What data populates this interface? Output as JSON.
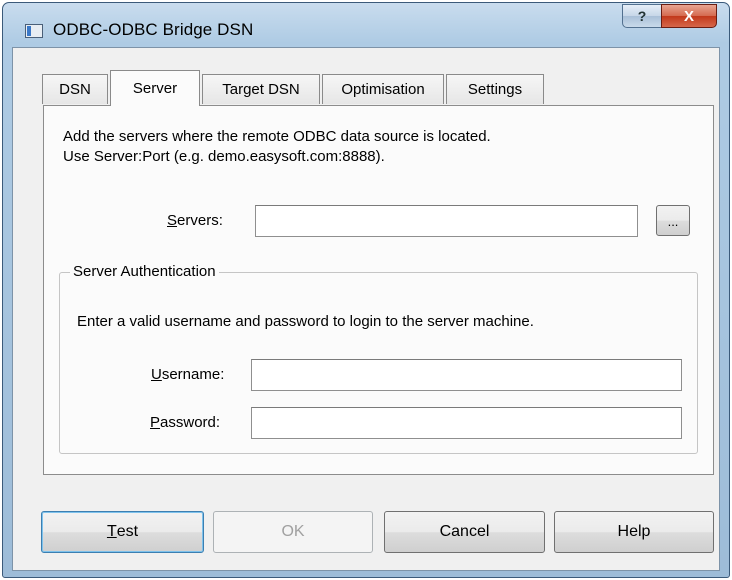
{
  "window": {
    "title": "ODBC-ODBC Bridge DSN"
  },
  "caption_buttons": {
    "help": "?",
    "close": "X"
  },
  "tabs": [
    {
      "label": "DSN"
    },
    {
      "label": "Server"
    },
    {
      "label": "Target DSN"
    },
    {
      "label": "Optimisation"
    },
    {
      "label": "Settings"
    }
  ],
  "active_tab": "Server",
  "server_tab": {
    "info_line1": "Add the servers where the remote ODBC data source is located.",
    "info_line2": "Use Server:Port (e.g. demo.easysoft.com:8888).",
    "servers": {
      "label_mnemonic": "S",
      "label_rest": "ervers:",
      "value": ""
    },
    "browse_label": "...",
    "auth": {
      "group_title": "Server Authentication",
      "hint": "Enter a valid username and password to login to the server machine.",
      "username": {
        "label_mnemonic": "U",
        "label_rest": "sername:",
        "value": ""
      },
      "password": {
        "label_mnemonic": "P",
        "label_rest": "assword:",
        "value": ""
      }
    }
  },
  "buttons": {
    "test": {
      "mnemonic": "T",
      "rest": "est"
    },
    "ok": "OK",
    "cancel": "Cancel",
    "help": "Help"
  }
}
